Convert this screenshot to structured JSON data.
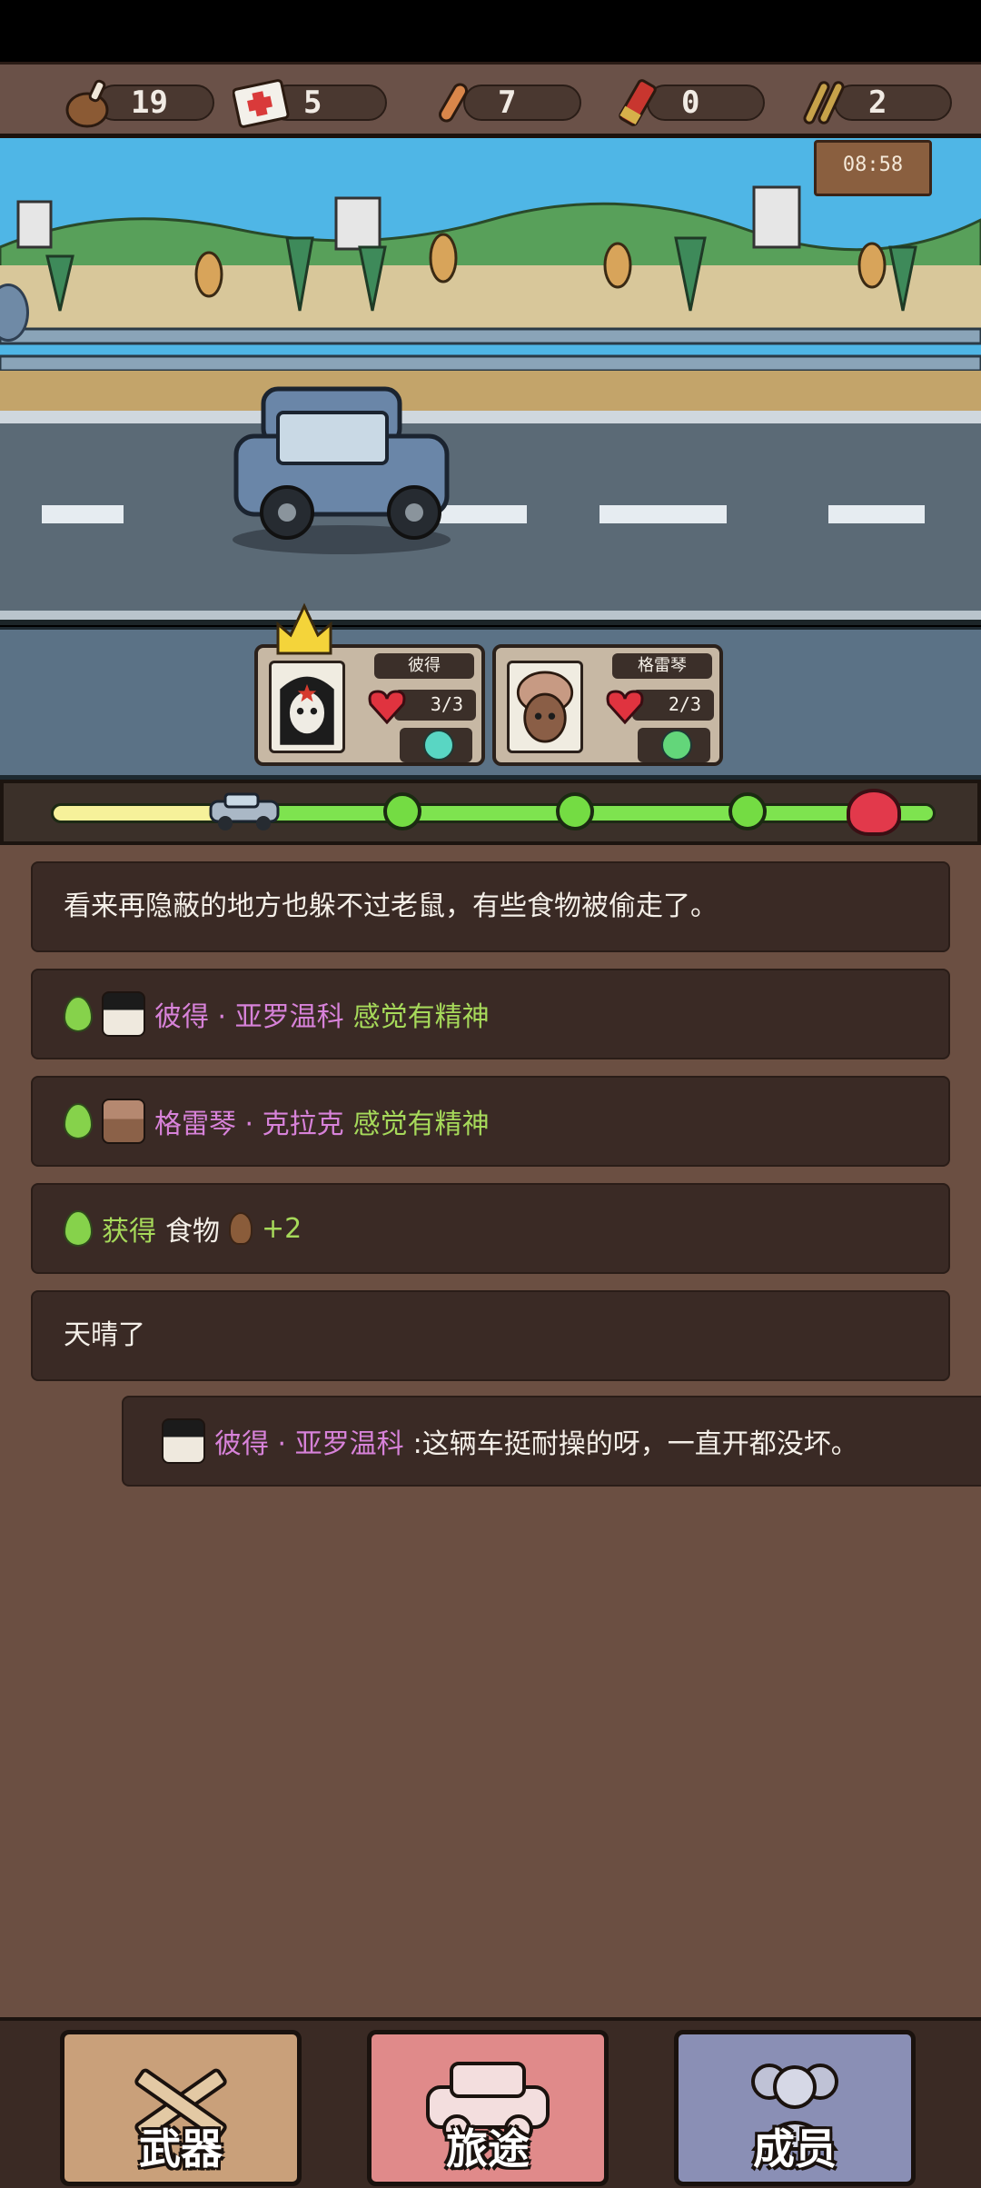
{
  "resources": [
    {
      "icon": "meat-icon",
      "value": "19"
    },
    {
      "icon": "medkit-icon",
      "value": "5"
    },
    {
      "icon": "bullet-icon",
      "value": "7"
    },
    {
      "icon": "shotgun-shell-icon",
      "value": "0"
    },
    {
      "icon": "rifle-ammo-icon",
      "value": "2"
    }
  ],
  "scene": {
    "timer": "08:58"
  },
  "team": [
    {
      "name": "彼得",
      "hp": "3/3",
      "mood": "neutral-face-icon",
      "leader": true
    },
    {
      "name": "格雷琴",
      "hp": "2/3",
      "mood": "smile-face-icon",
      "leader": false
    }
  ],
  "progress": {
    "done_fraction": 0.17,
    "checkpoints": 3,
    "end_icon": "skull-icon"
  },
  "log": {
    "l1": "看来再隐蔽的地方也躲不过老鼠，有些食物被偷走了。",
    "l2_name": "彼得 · 亚罗温科",
    "l2_status": "感觉有精神",
    "l3_name": "格雷琴 · 克拉克",
    "l3_status": "感觉有精神",
    "l4_gain": "获得",
    "l4_item": "食物",
    "l4_amount": "+2",
    "l5": "天晴了",
    "dialog_name": "彼得 · 亚罗温科",
    "dialog_text": ":这辆车挺耐操的呀，一直开都没坏。"
  },
  "nav": {
    "weapons": "武器",
    "journey": "旅途",
    "members": "成员"
  },
  "colors": {
    "name_pink": "#d782d9",
    "status_green": "#a6d95a",
    "log_card": "#3a2a25",
    "log_bg": "#6b4f42"
  }
}
